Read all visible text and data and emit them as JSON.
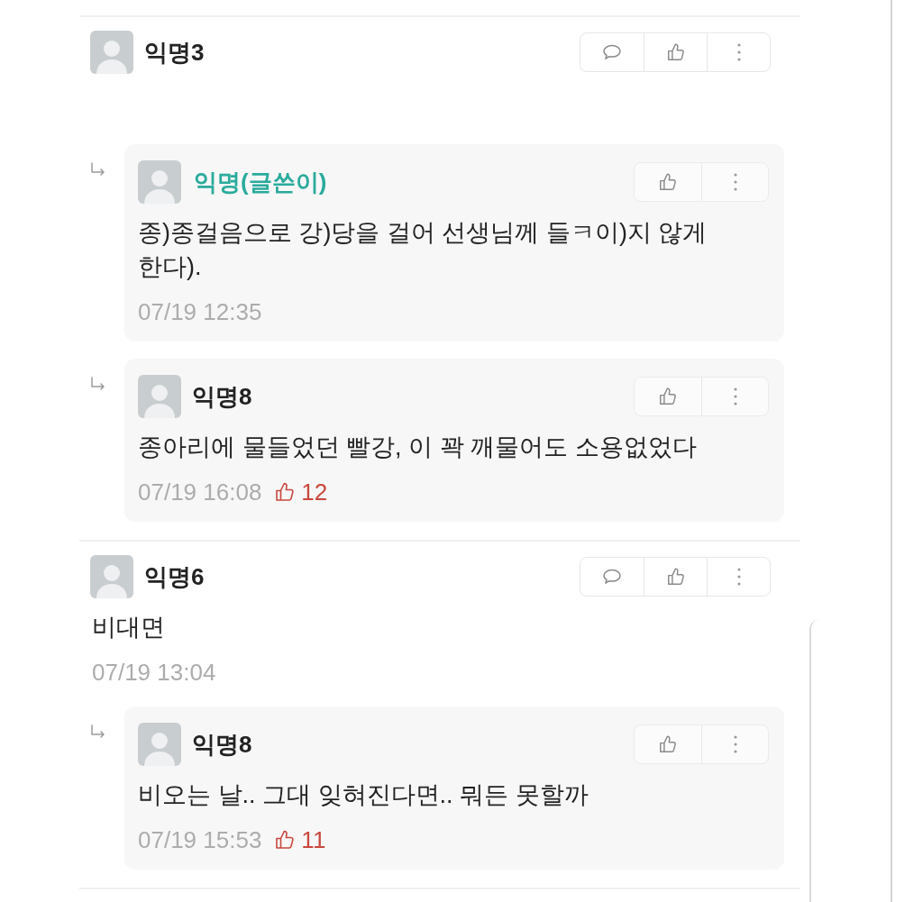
{
  "comments": [
    {
      "author": "익명3",
      "writer": false,
      "children": [
        {
          "author": "익명(글쓴이)",
          "writer": true,
          "text": "종)종걸음으로 강)당을 걸어 선생님께 들ㅋ이)지 않게 한다).",
          "time": "07/19 12:35"
        },
        {
          "author": "익명8",
          "writer": false,
          "text": "종아리에 물들었던 빨강, 이 꽉 깨물어도 소용없었다",
          "time": "07/19 16:08",
          "likes": "12"
        }
      ]
    },
    {
      "author": "익명6",
      "writer": false,
      "text": "비대면",
      "time": "07/19 13:04",
      "children": [
        {
          "author": "익명8",
          "writer": false,
          "text": "비오는 날.. 그대 잊혀진다면.. 뭐든 못할까",
          "time": "07/19 15:53",
          "likes": "11"
        }
      ]
    }
  ]
}
